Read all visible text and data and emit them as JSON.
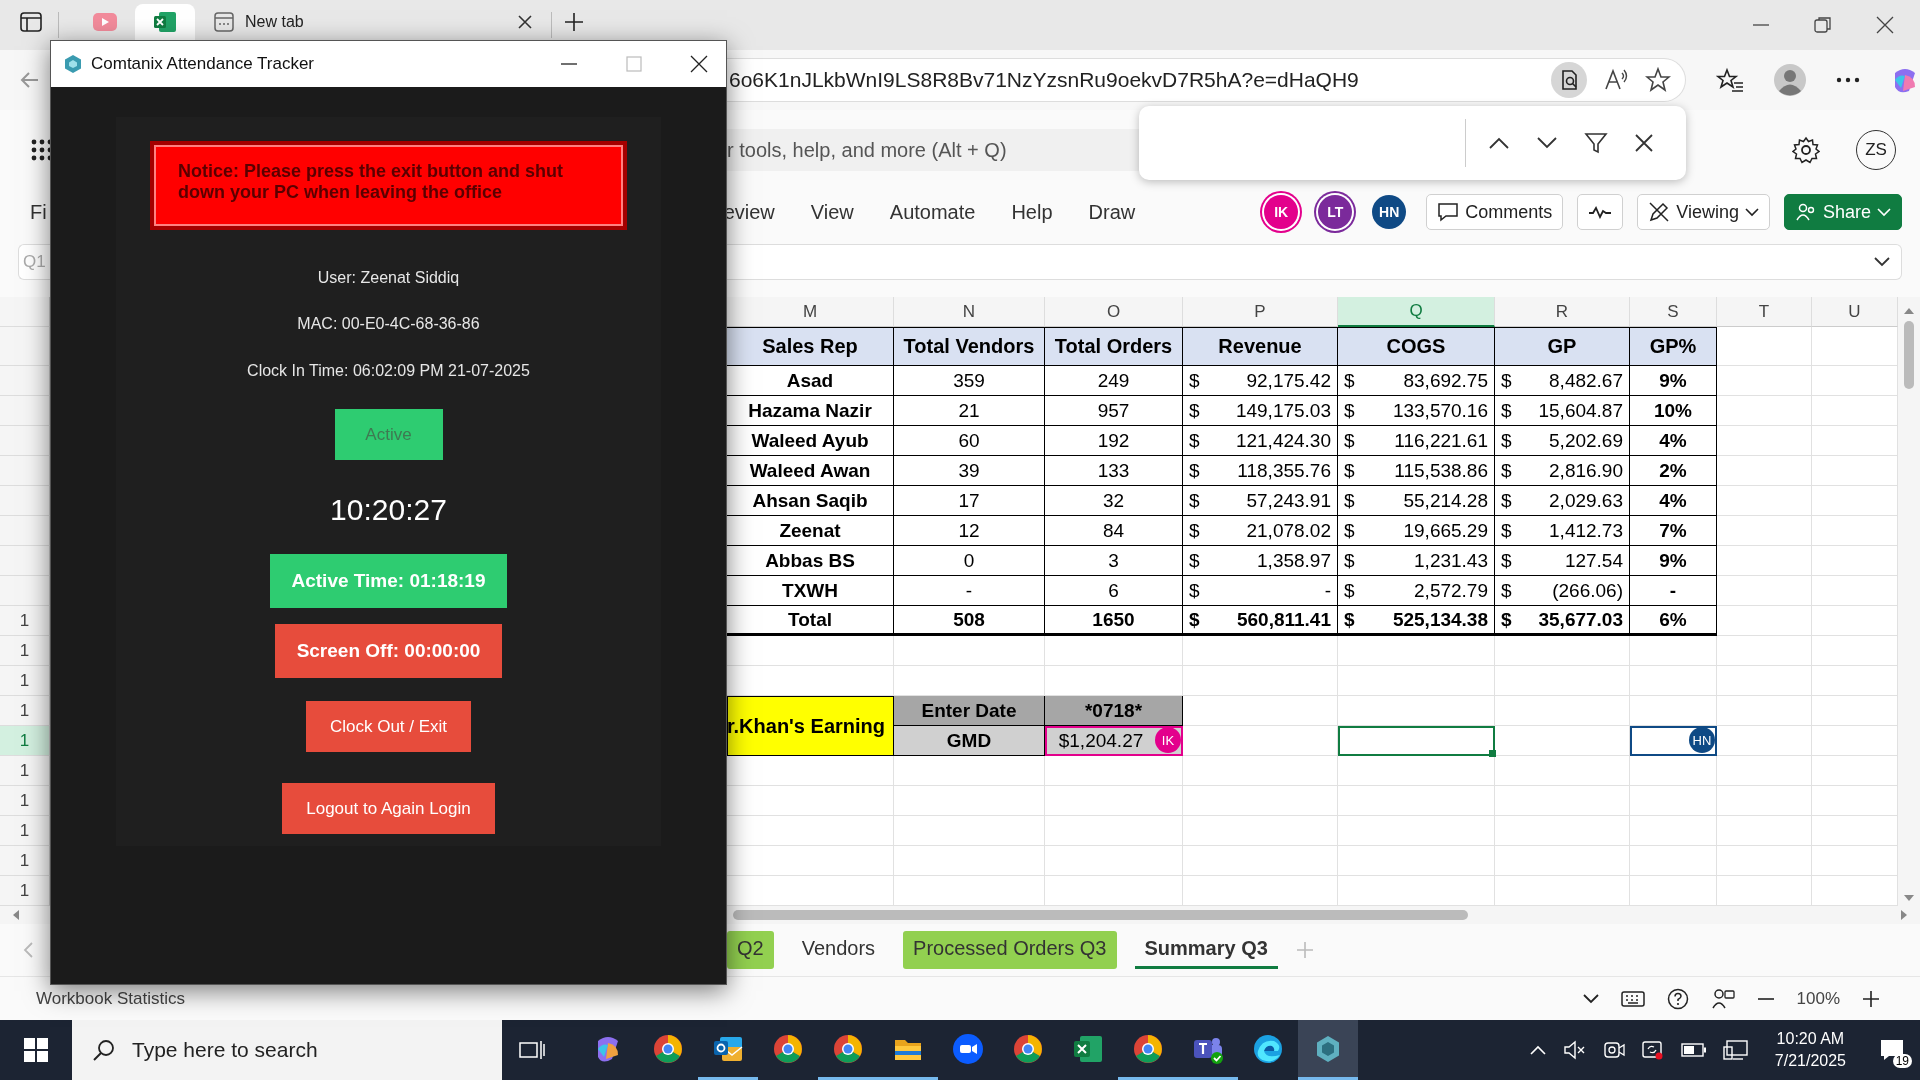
{
  "browser": {
    "tabs": [
      {
        "kind": "video",
        "selected": false
      },
      {
        "kind": "spreadsheet",
        "selected": true
      },
      {
        "kind": "page",
        "label": "New tab",
        "selected": false
      }
    ],
    "url": "6o6K1nJLkbWnI9LS8R8Bv71NzYzsnRu9oekvD7R5hA?e=dHaQH9"
  },
  "excel": {
    "search_placeholder": "r tools, help, and more (Alt + Q)",
    "account": "ZS",
    "ribbon_tabs": [
      "Fi",
      "eview",
      "View",
      "Automate",
      "Help",
      "Draw"
    ],
    "collaborators": [
      {
        "initials": "IK",
        "color": "#e3008c",
        "active": true
      },
      {
        "initials": "LT",
        "color": "#7b2a9b",
        "active": true
      },
      {
        "initials": "HN",
        "color": "#0f4a85",
        "active": false
      }
    ],
    "comments": "Comments",
    "viewing": "Viewing",
    "share": "Share",
    "name_box": "Q1"
  },
  "sheet": {
    "columns": [
      {
        "label": "M",
        "selected": false
      },
      {
        "label": "N",
        "selected": false
      },
      {
        "label": "O",
        "selected": false
      },
      {
        "label": "P",
        "selected": false
      },
      {
        "label": "Q",
        "selected": true
      },
      {
        "label": "R",
        "selected": false
      },
      {
        "label": "S",
        "selected": false
      },
      {
        "label": "T",
        "selected": false
      },
      {
        "label": "U",
        "selected": false
      }
    ],
    "row_numbers": [
      {
        "label": "1",
        "selected": false
      },
      {
        "label": "1",
        "selected": false
      },
      {
        "label": "1",
        "selected": false
      },
      {
        "label": "1",
        "selected": false
      },
      {
        "label": "1",
        "selected": true
      },
      {
        "label": "1",
        "selected": false
      },
      {
        "label": "1",
        "selected": false
      },
      {
        "label": "1",
        "selected": false
      },
      {
        "label": "1",
        "selected": false
      },
      {
        "label": "1",
        "selected": false
      }
    ],
    "table": {
      "headers": [
        "Sales Rep",
        "Total Vendors",
        "Total Orders",
        "Revenue",
        "COGS",
        "GP",
        "GP%"
      ],
      "rows": [
        {
          "kind": "data",
          "cells": [
            "Asad",
            "359",
            "249",
            {
              "symbol": "$",
              "amount": "92,175.42"
            },
            {
              "symbol": "$",
              "amount": "83,692.75"
            },
            {
              "symbol": "$",
              "amount": "8,482.67"
            },
            "9%"
          ]
        },
        {
          "kind": "data",
          "cells": [
            "Hazama Nazir",
            "21",
            "957",
            {
              "symbol": "$",
              "amount": "149,175.03"
            },
            {
              "symbol": "$",
              "amount": "133,570.16"
            },
            {
              "symbol": "$",
              "amount": "15,604.87"
            },
            "10%"
          ]
        },
        {
          "kind": "data",
          "cells": [
            "Waleed Ayub",
            "60",
            "192",
            {
              "symbol": "$",
              "amount": "121,424.30"
            },
            {
              "symbol": "$",
              "amount": "116,221.61"
            },
            {
              "symbol": "$",
              "amount": "5,202.69"
            },
            "4%"
          ]
        },
        {
          "kind": "data",
          "cells": [
            "Waleed Awan",
            "39",
            "133",
            {
              "symbol": "$",
              "amount": "118,355.76"
            },
            {
              "symbol": "$",
              "amount": "115,538.86"
            },
            {
              "symbol": "$",
              "amount": "2,816.90"
            },
            "2%"
          ]
        },
        {
          "kind": "data",
          "cells": [
            "Ahsan Saqib",
            "17",
            "32",
            {
              "symbol": "$",
              "amount": "57,243.91"
            },
            {
              "symbol": "$",
              "amount": "55,214.28"
            },
            {
              "symbol": "$",
              "amount": "2,029.63"
            },
            "4%"
          ]
        },
        {
          "kind": "data",
          "cells": [
            "Zeenat",
            "12",
            "84",
            {
              "symbol": "$",
              "amount": "21,078.02"
            },
            {
              "symbol": "$",
              "amount": "19,665.29"
            },
            {
              "symbol": "$",
              "amount": "1,412.73"
            },
            "7%"
          ]
        },
        {
          "kind": "data",
          "cells": [
            "Abbas BS",
            "0",
            "3",
            {
              "symbol": "$",
              "amount": "1,358.97"
            },
            {
              "symbol": "$",
              "amount": "1,231.43"
            },
            {
              "symbol": "$",
              "amount": "127.54"
            },
            "9%"
          ]
        },
        {
          "kind": "data",
          "cells": [
            "TXWH",
            "-",
            "6",
            {
              "symbol": "$",
              "amount": "-"
            },
            {
              "symbol": "$",
              "amount": "2,572.79"
            },
            {
              "symbol": "$",
              "amount": "(266.06)"
            },
            "-"
          ]
        },
        {
          "kind": "total",
          "cells": [
            "Total",
            "508",
            "1650",
            {
              "symbol": "$",
              "amount": "560,811.41"
            },
            {
              "symbol": "$",
              "amount": "525,134.38"
            },
            {
              "symbol": "$",
              "amount": "35,677.03"
            },
            "6%"
          ]
        }
      ]
    },
    "earnings": {
      "label": "r.Khan's Earning",
      "rows": [
        {
          "label": "Enter Date",
          "value": "*0718*",
          "kind": "dark"
        },
        {
          "label": "GMD",
          "value": "$1,204.27",
          "kind": "light",
          "cursor": {
            "initials": "IK",
            "color": "#e3008c"
          },
          "trailing": [
            {
              "kind": "empty"
            },
            {
              "kind": "own",
              "color": "#107c41"
            },
            {
              "kind": "empty"
            },
            {
              "kind": "collaborator",
              "initials": "HN",
              "color": "#0f4a85"
            },
            {
              "kind": "empty"
            },
            {
              "kind": "empty"
            }
          ]
        }
      ]
    }
  },
  "sheet_tabs": [
    {
      "label": "Q2",
      "color": "#92d050",
      "selected": false
    },
    {
      "label": "Vendors",
      "selected": false
    },
    {
      "label": "Processed Orders Q3",
      "color": "#92d050",
      "selected": false
    },
    {
      "label": "Summary Q3",
      "selected": true
    }
  ],
  "status_bar": {
    "label": "Workbook Statistics",
    "zoom": "100%"
  },
  "tracker": {
    "title": "Comtanix Attendance Tracker",
    "notice": "Notice: Please press the exit button and shut down your PC when leaving the office",
    "user": "User: Zeenat Siddiq",
    "mac": "MAC: 00-E0-4C-68-36-86",
    "clock_in": "Clock In Time: 06:02:09 PM 21-07-2025",
    "status": "Active",
    "clock": "10:20:27",
    "buttons": [
      {
        "label": "Active Time: 01:18:19",
        "kind": "metric",
        "color": "#2ecc71"
      },
      {
        "label": "Screen Off: 00:00:00",
        "kind": "metric",
        "color": "#e74c3c"
      },
      {
        "label": "Clock Out / Exit",
        "kind": "action",
        "color": "#e74c3c"
      },
      {
        "label": "Logout to Again Login",
        "kind": "action",
        "color": "#e74c3c"
      }
    ]
  },
  "taskbar": {
    "search_placeholder": "Type here to search",
    "apps": [
      {
        "kind": "assistant",
        "running": false
      },
      {
        "kind": "browser",
        "running": false
      },
      {
        "kind": "mail",
        "running": true
      },
      {
        "kind": "browser",
        "running": false
      },
      {
        "kind": "browser",
        "running": true
      },
      {
        "kind": "folder",
        "running": true
      },
      {
        "kind": "video",
        "running": false
      },
      {
        "kind": "browser",
        "running": false
      },
      {
        "kind": "spreadsheet",
        "running": false
      },
      {
        "kind": "browser",
        "running": true
      },
      {
        "kind": "chat",
        "running": true
      },
      {
        "kind": "web",
        "running": false
      },
      {
        "kind": "tracker",
        "running": true
      }
    ],
    "time": "10:20 AM",
    "date": "7/21/2025",
    "notifications": "19"
  }
}
